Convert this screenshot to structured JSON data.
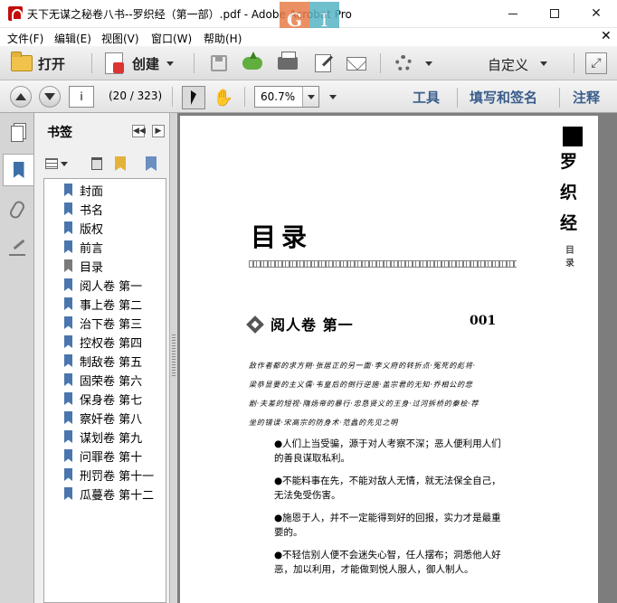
{
  "window": {
    "title": "天下无谋之秘卷八书--罗织经（第一部）.pdf - Adobe Acrobat Pro",
    "watermark_letters": [
      "G",
      "I"
    ]
  },
  "menu": [
    "文件(F)",
    "编辑(E)",
    "视图(V)",
    "窗口(W)",
    "帮助(H)"
  ],
  "toolbar": {
    "open_label": "打开",
    "create_label": "创建",
    "customize_label": "自定义"
  },
  "nav": {
    "page_input_value": "i",
    "page_count": "(20 / 323)",
    "zoom": "60.7%"
  },
  "panels": {
    "tools": "工具",
    "fill_sign": "填写和签名",
    "comment": "注释"
  },
  "bookmarks": {
    "title": "书签",
    "items": [
      {
        "label": "封面"
      },
      {
        "label": "书名"
      },
      {
        "label": "版权"
      },
      {
        "label": "前言"
      },
      {
        "label": "目录"
      },
      {
        "label": "阅人卷 第一"
      },
      {
        "label": "事上卷 第二"
      },
      {
        "label": "治下卷 第三"
      },
      {
        "label": "控权卷 第四"
      },
      {
        "label": "制敌卷 第五"
      },
      {
        "label": "固荣卷 第六"
      },
      {
        "label": "保身卷 第七"
      },
      {
        "label": "察奸卷 第八"
      },
      {
        "label": "谋划卷 第九"
      },
      {
        "label": "问罪卷 第十"
      },
      {
        "label": "刑罚卷 第十一"
      },
      {
        "label": "瓜蔓卷 第十二"
      }
    ]
  },
  "document": {
    "vertical_title": [
      "罗",
      "织",
      "经"
    ],
    "vertical_sub": [
      "目",
      "录"
    ],
    "toc_heading": "目录",
    "section_title": "阅人卷  第一",
    "section_page": "001",
    "summary_lines": [
      "敌作者都的求方朔·张居正的另一面·李义府的转折点·冤死的彪将·",
      "梁恭显要的主义儒·韦皇后的倒行逆施·盖宗君的无知·乔相公的悲",
      "剧·夫差的短视·隋炀帝的暴行·忠恳贤义的王身·过河拆桥的秦桧·荐",
      "坐的错误·宋高宗的防身术·范蠡的先见之明"
    ],
    "bullets": [
      "●人们上当受骗，源于对人考察不深；恶人便利用人们的善良谋取私利。",
      "●不能料事在先，不能对敌人无情，就无法保全自己，无法免受伤害。",
      "●施恩于人，并不一定能得到好的回报，实力才是最重要的。",
      "●不轻信别人便不会迷失心智，任人摆布；洞悉他人好恶，加以利用，才能做到悦人服人，御人制人。"
    ]
  }
}
